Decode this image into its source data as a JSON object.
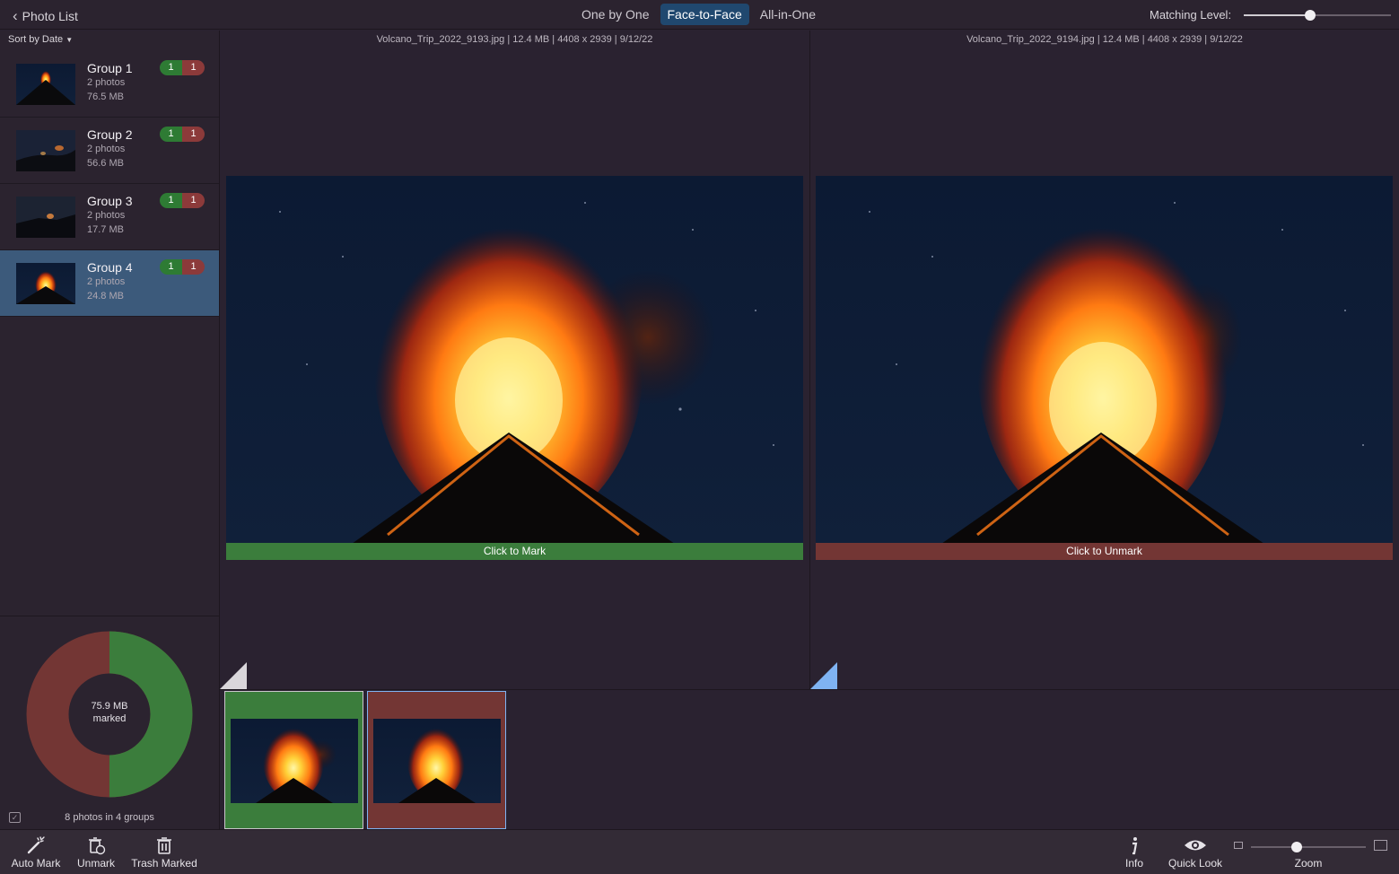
{
  "header": {
    "back_label": "Photo List",
    "modes": [
      "One by One",
      "Face-to-Face",
      "All-in-One"
    ],
    "active_mode": "Face-to-Face",
    "matching_label": "Matching Level:",
    "matching_level": 0.45
  },
  "sidebar": {
    "sort_label": "Sort by Date",
    "groups": [
      {
        "name": "Group 1",
        "photos": "2 photos",
        "size": "76.5 MB",
        "green": "1",
        "red": "1"
      },
      {
        "name": "Group 2",
        "photos": "2 photos",
        "size": "56.6 MB",
        "green": "1",
        "red": "1"
      },
      {
        "name": "Group 3",
        "photos": "2 photos",
        "size": "17.7 MB",
        "green": "1",
        "red": "1"
      },
      {
        "name": "Group 4",
        "photos": "2 photos",
        "size": "24.8 MB",
        "green": "1",
        "red": "1"
      }
    ],
    "selected_group": "Group 4",
    "summary": {
      "marked_size": "75.9 MB",
      "marked_label": "marked",
      "count_text": "8 photos in 4 groups",
      "marked_fraction": 0.5
    }
  },
  "left_photo": {
    "info": "Volcano_Trip_2022_9193.jpg | 12.4 MB | 4408 x 2939 | 9/12/22",
    "action": "Click to Mark"
  },
  "right_photo": {
    "info": "Volcano_Trip_2022_9194.jpg | 12.4 MB | 4408 x 2939 | 9/12/22",
    "action": "Click to Unmark"
  },
  "toolbar": {
    "auto_mark": "Auto Mark",
    "unmark": "Unmark",
    "trash_marked": "Trash Marked",
    "info": "Info",
    "quick_look": "Quick Look",
    "zoom": "Zoom",
    "zoom_level": 0.4
  },
  "colors": {
    "keep": "#3b7d3c",
    "mark": "#733634",
    "accent": "#20486f"
  }
}
